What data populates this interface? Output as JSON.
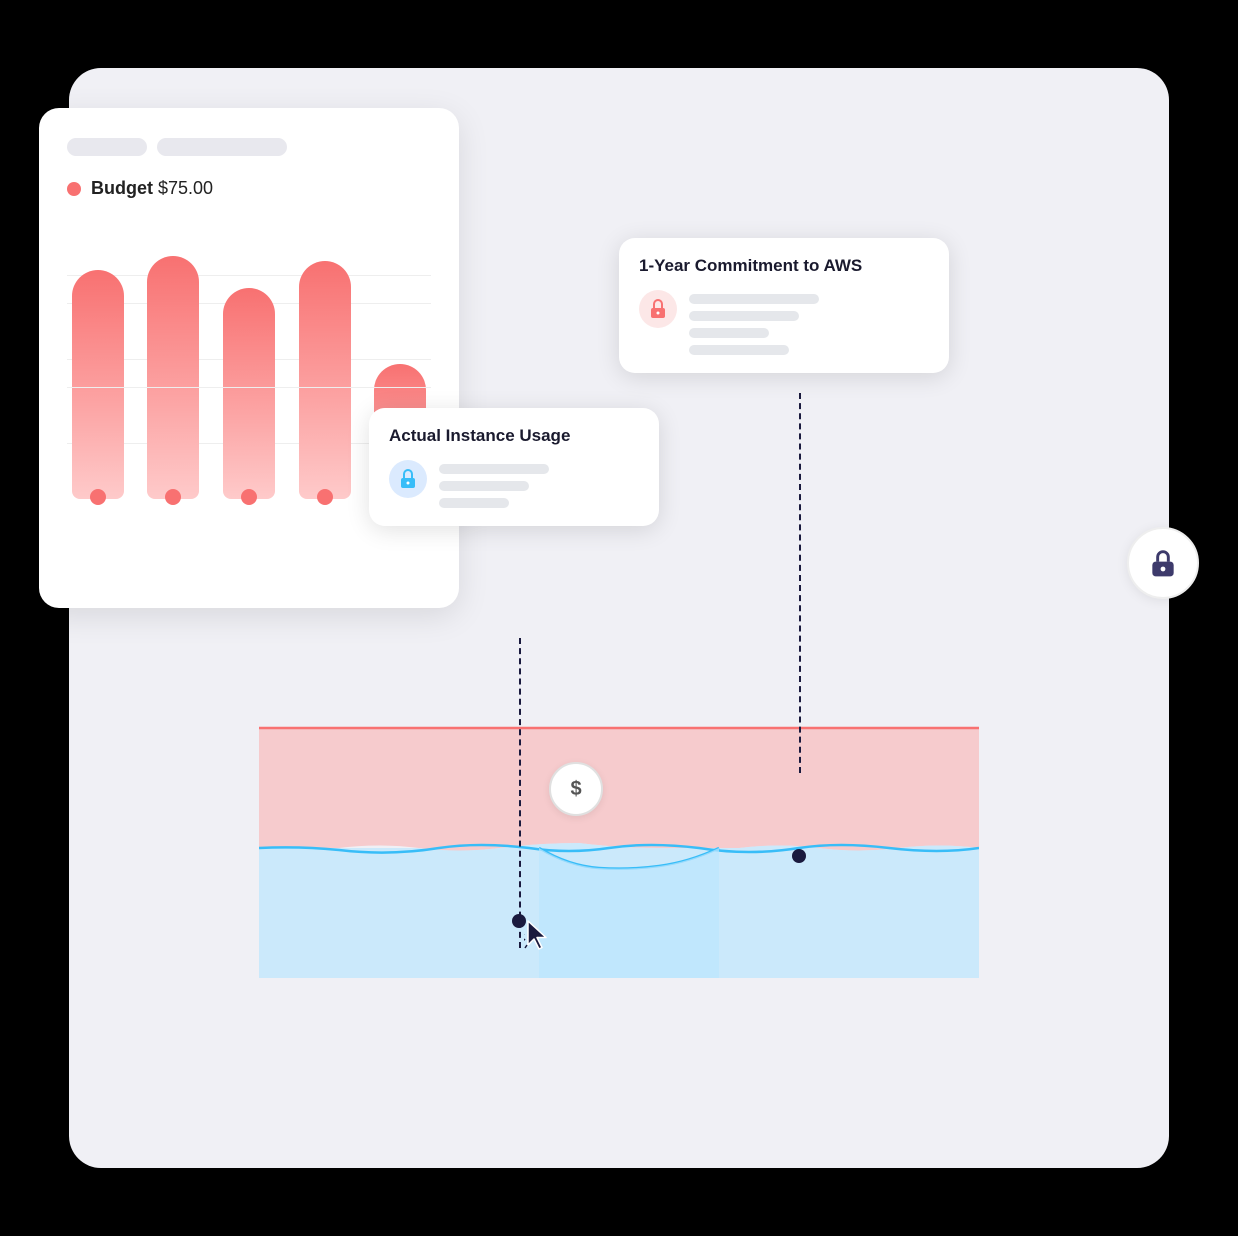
{
  "budget_card": {
    "legend_label": "Budget",
    "legend_value": "$75.00",
    "bars": [
      {
        "height_pct": 85
      },
      {
        "height_pct": 90
      },
      {
        "height_pct": 78
      },
      {
        "height_pct": 88
      },
      {
        "height_pct": 50
      }
    ]
  },
  "commitment_tooltip": {
    "title": "1-Year Commitment to AWS",
    "lines": [
      100,
      130,
      80,
      100
    ]
  },
  "usage_tooltip": {
    "title": "Actual Instance Usage",
    "lines": [
      110,
      90,
      70
    ]
  },
  "lock_circle": {
    "label": "lock-icon"
  },
  "dollar_circle": {
    "symbol": "$"
  },
  "colors": {
    "pink_area": "#fca5a5",
    "blue_area": "#bae6fd",
    "pink_light": "#fce7e7",
    "blue_light": "#dbeafe",
    "dark_navy": "#1a1a3e",
    "accent_blue": "#38bdf8",
    "accent_pink": "#f87171"
  }
}
